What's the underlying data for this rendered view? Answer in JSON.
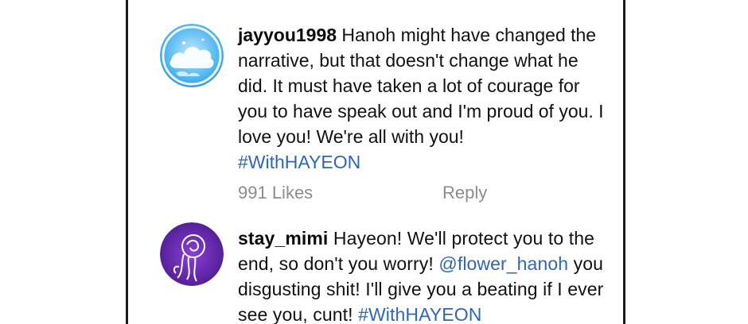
{
  "comments": [
    {
      "username": "jayyou1998",
      "text": "Hanoh might have changed the narrative, but that doesn't change what he did. It must have taken a lot of courage for you to have speak out and I'm proud of you. I love you! We're all with you!",
      "hashtag": "#WithHAYEON",
      "likes": "991 Likes",
      "reply": "Reply",
      "avatar_icon": "sky-cloud-avatar-icon"
    },
    {
      "username": "stay_mimi",
      "text_part1": "Hayeon! We'll protect you to the end, so don't you worry!",
      "mention": "@flower_hanoh",
      "text_part2": "you disgusting shit! I'll give you a beating if I ever see you, cunt!",
      "hashtag": "#WithHAYEON",
      "avatar_icon": "rose-avatar-icon"
    }
  ],
  "colors": {
    "link": "#2d67b5",
    "meta": "#8c8c8c",
    "border": "#1a1a1a"
  }
}
